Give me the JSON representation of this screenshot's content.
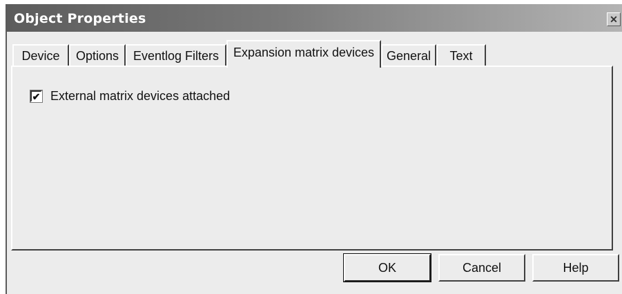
{
  "window": {
    "title": "Object Properties",
    "close_glyph": "✕"
  },
  "tabs": [
    {
      "label": "Device",
      "active": false
    },
    {
      "label": "Options",
      "active": false
    },
    {
      "label": "Eventlog Filters",
      "active": false
    },
    {
      "label": "Expansion matrix devices",
      "active": true
    },
    {
      "label": "General",
      "active": false
    },
    {
      "label": "Text",
      "active": false
    }
  ],
  "panel": {
    "checkbox": {
      "label": "External matrix devices attached",
      "checked": true,
      "check_glyph": "✔"
    }
  },
  "buttons": {
    "ok": "OK",
    "cancel": "Cancel",
    "help": "Help"
  }
}
